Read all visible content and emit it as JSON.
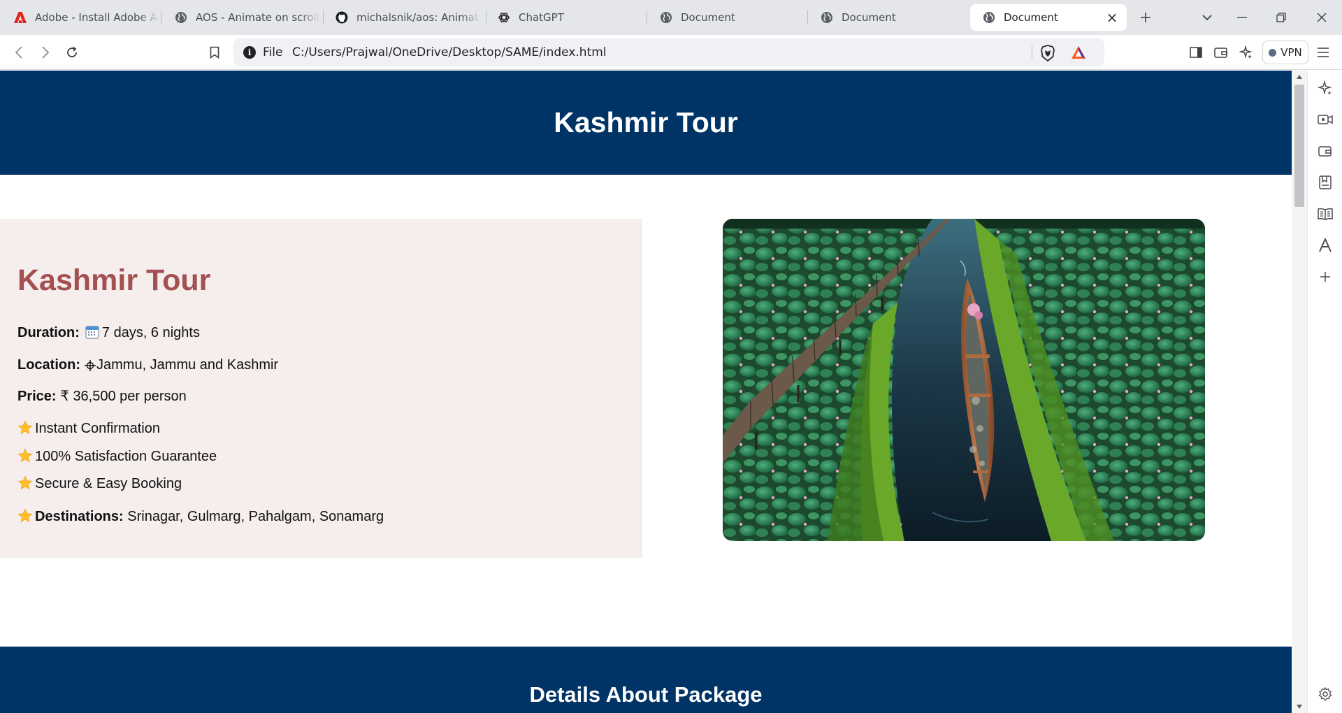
{
  "browser": {
    "tabs": [
      {
        "label": "Adobe - Install Adobe Acrobat",
        "icon": "adobe-icon",
        "active": false
      },
      {
        "label": "AOS - Animate on scroll library",
        "icon": "globe-icon",
        "active": false
      },
      {
        "label": "michalsnik/aos: Animate on scroll",
        "icon": "github-icon",
        "active": false
      },
      {
        "label": "ChatGPT",
        "icon": "chatgpt-icon",
        "active": false
      },
      {
        "label": "Document",
        "icon": "globe-icon",
        "active": false
      },
      {
        "label": "Document",
        "icon": "globe-icon",
        "active": false
      },
      {
        "label": "Document",
        "icon": "globe-icon",
        "active": true
      }
    ],
    "address": {
      "scheme_label": "File",
      "url": "C:/Users/Prajwal/OneDrive/Desktop/SAME/index.html"
    },
    "vpn_label": "VPN",
    "colors": {
      "tabbar": "#e4e6ea",
      "adobe_red": "#e0251b",
      "brave_orange": "#ff5a1f"
    }
  },
  "page": {
    "header_title": "Kashmir Tour",
    "tour": {
      "title": "Kashmir Tour",
      "duration_label": "Duration:",
      "duration_value": "7 days, 6 nights",
      "location_label": "Location:",
      "location_value": "Jammu, Jammu and Kashmir",
      "price_label": "Price:",
      "price_value": "₹ 36,500 per person",
      "features": [
        "Instant Confirmation",
        "100% Satisfaction Guarantee",
        "Secure & Easy Booking"
      ],
      "destinations_label": "Destinations:",
      "destinations_value": "Srinagar, Gulmarg, Pahalgam, Sonamarg"
    },
    "details_title": "Details About Package",
    "colors": {
      "header_bg": "#003366",
      "card_bg": "#f6eded",
      "title_color": "#a35052"
    }
  }
}
